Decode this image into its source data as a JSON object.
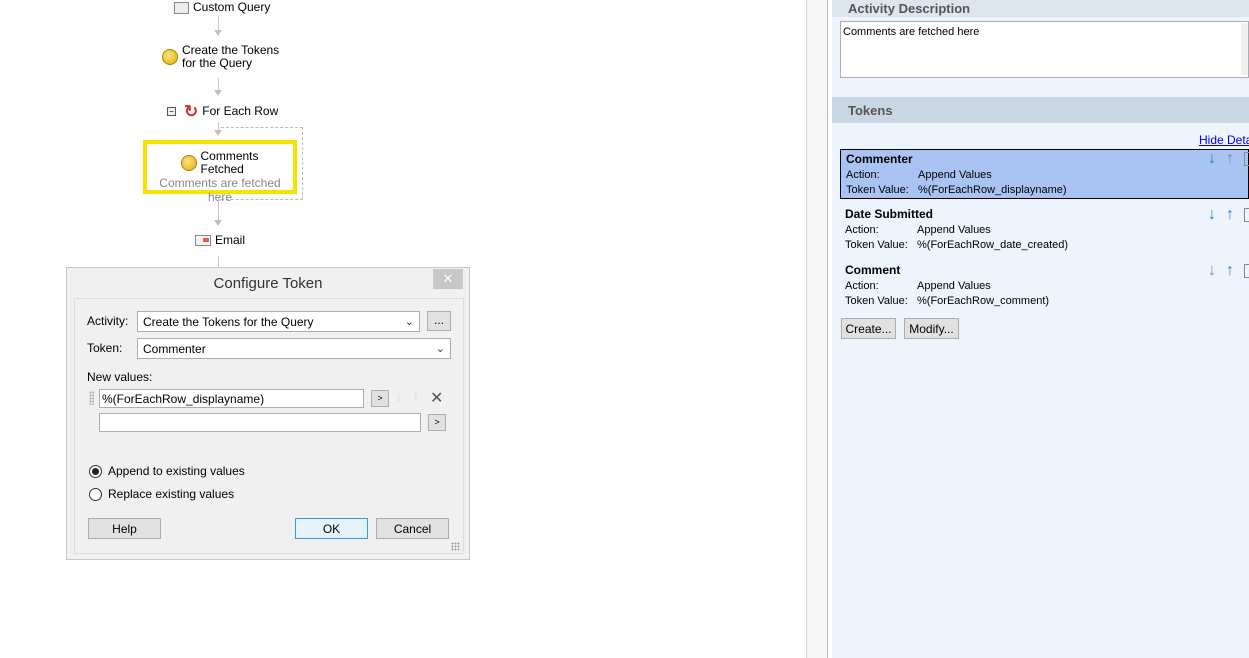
{
  "workflow": {
    "nodes": [
      "Custom Query",
      "Create the Tokens\nfor the Query",
      "For Each Row",
      "Comments\nFetched",
      "Email"
    ],
    "selected_description": "Comments are fetched here"
  },
  "dialog": {
    "title": "Configure Token",
    "close": "✕",
    "activity_label": "Activity:",
    "activity_value": "Create the Tokens for the Query",
    "browse": "...",
    "token_label": "Token:",
    "token_value": "Commenter",
    "new_values_label": "New values:",
    "values": [
      "%(ForEachRow_displayname)",
      ""
    ],
    "insert": ">",
    "remove": "✕",
    "radio_append": "Append to existing values",
    "radio_replace": "Replace existing values",
    "append_selected": true,
    "help": "Help",
    "ok": "OK",
    "cancel": "Cancel"
  },
  "panel": {
    "activity_description_header": "Activity Description",
    "description": "Comments are fetched here",
    "tokens_header": "Tokens",
    "hide_details": "Hide Details",
    "action_label": "Action:",
    "value_label": "Token Value:",
    "tokens": [
      {
        "name": "Commenter",
        "action": "Append Values",
        "value": "%(ForEachRow_displayname)"
      },
      {
        "name": "Date Submitted",
        "action": "Append Values",
        "value": "%(ForEachRow_date_created)"
      },
      {
        "name": "Comment",
        "action": "Append Values",
        "value": "%(ForEachRow_comment)"
      }
    ],
    "create": "Create...",
    "modify": "Modify..."
  }
}
